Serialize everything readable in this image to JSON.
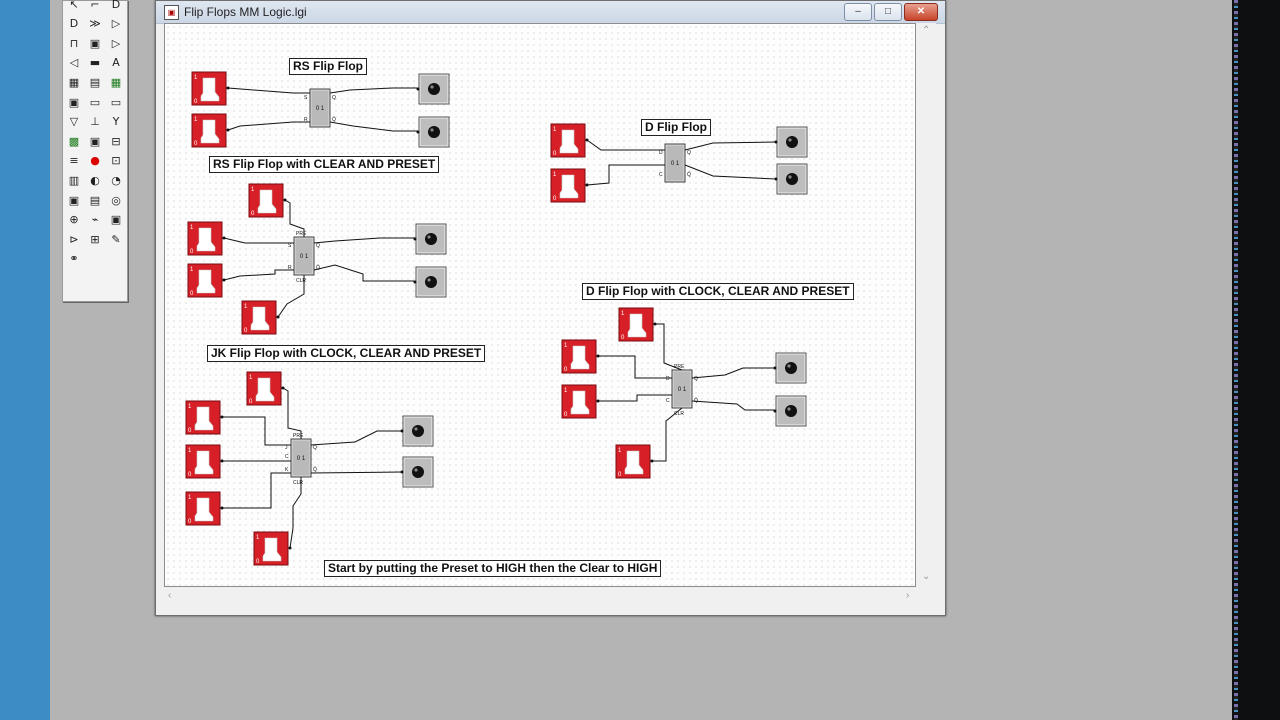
{
  "window": {
    "title": "Flip Flops MM Logic.lgi",
    "minimize": "–",
    "maximize": "□",
    "close": "✕"
  },
  "toolbox": {
    "tools": [
      "pointer-tool",
      "wire-tool",
      "and-gate-tool",
      "or-gate-tool",
      "xor-gate-tool",
      "buffer-tool",
      "clock-tool",
      "module-tool",
      "inverter-tool",
      "speaker-tool",
      "number-tool",
      "keyboard-tool",
      "text-tool",
      "ascii-tool",
      "grid-tool",
      "display-tool",
      "bus-tool",
      "nand-tool",
      "register-tool",
      "ground-tool",
      "filter-tool",
      "chip-tool",
      "flipflop-tool",
      "switch-tool",
      "power-tool",
      "probe-tool",
      "led-tool",
      "memory-tool",
      "counter-tool",
      "decoder-tool",
      "adder-tool",
      "encoder-tool",
      "timer-tool",
      "light-tool",
      "bulb-tool",
      "seven-seg-tool",
      "signal-tool",
      "mux-tool",
      "pen-tool",
      "connector-tool"
    ]
  },
  "labels": {
    "rs": "RS Flip Flop",
    "rs_cp": "RS Flip Flop with CLEAR AND PRESET",
    "d": "D Flip Flop",
    "d_ccp": "D Flip Flop with CLOCK, CLEAR AND PRESET",
    "jk_ccp": "JK Flip Flop with CLOCK, CLEAR AND PRESET",
    "instructions": "Start by putting the Preset to HIGH then the Clear to HIGH"
  },
  "chip": {
    "body": "0 1",
    "pin_s": "S",
    "pin_r": "R",
    "pin_d": "D",
    "pin_c": "C",
    "pin_j": "J",
    "pin_k": "K",
    "pin_q": "Q",
    "pin_qbar": "Q̄",
    "pin_pre": "PRE",
    "pin_clr": "CLR"
  },
  "switch": {
    "high": "1",
    "low": "0"
  },
  "colors": {
    "switch_red": "#d61f26",
    "led_gray": "#bdbdbd",
    "chip_gray": "#b9b9b9",
    "wire": "#111111"
  }
}
